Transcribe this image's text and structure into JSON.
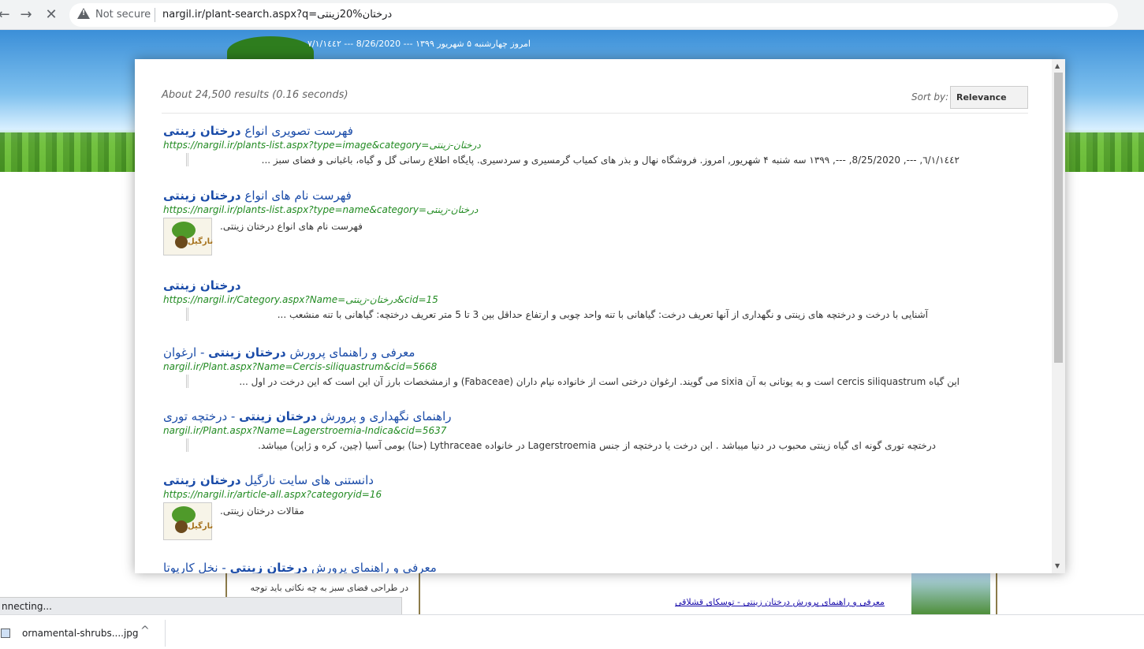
{
  "browser": {
    "back": "←",
    "forward": "→",
    "stop": "✕",
    "not_secure": "Not secure",
    "url": "nargil.ir/plant-search.aspx?q=درختان%20زینتی"
  },
  "page": {
    "date_line": "امروز چهارشنبه ۵ شهریور ۱۳۹۹  ---  8/26/2020  ---  ٧/١/١٤٤٢",
    "bottom_text": "در طراحی فضای سبز به چه نکاتی باید توجه",
    "bottom_link": "معرفی و راهنمای پرورش درختان زینتی - توسکای قشلاقی",
    "status": "nnecting..."
  },
  "download": {
    "file_name": "ornamental-shrubs....jpg",
    "chevron": "^"
  },
  "search": {
    "results_info": "About 24,500 results (0.16 seconds)",
    "sort_label": "Sort by:",
    "sort_value": "Relevance",
    "results": [
      {
        "title_pre": "فهرست تصویری انواع ",
        "title_bold": "درختان زینتی",
        "title_post": "",
        "url": "https://nargil.ir/plants-list.aspx?type=image&category=درختان-زینتی",
        "snippet": "٦/١/١٤٤٢, ---, 8/25/2020, ---, ۱۳۹۹ سه شنبه ۴ شهریور, امروز. فروشگاه نهال و بذر های کمیاب گرمسیری و سردسیری. پایگاه اطلاع رسانی گل و گیاه، باغبانی و فضای سبز ..."
      },
      {
        "title_pre": "فهرست نام های انواع ",
        "title_bold": "درختان زینتی",
        "title_post": "",
        "url": "https://nargil.ir/plants-list.aspx?type=name&category=درختان-زینتی",
        "snippet": "فهرست نام های انواع درختان زینتی."
      },
      {
        "title_pre": "",
        "title_bold": "درختان زینتی",
        "title_post": "",
        "url": "https://nargil.ir/Category.aspx?Name=درختان-زینتی&cid=15",
        "snippet": "آشنایی با درخت و درختچه های زینتی و نگهداری از آنها تعریف درخت: گیاهانی با تنه واحد چوبی و ارتفاع حداقل بین 3 تا 5 متر تعریف درختچه: گیاهانی با تنه منشعب ..."
      },
      {
        "title_pre": "معرفی و راهنمای پرورش ",
        "title_bold": "درختان زینتی",
        "title_post": " - ارغوان",
        "url": "nargil.ir/Plant.aspx?Name=Cercis-siliquastrum&cid=5668",
        "snippet": "این گیاه cercis siliquastrum است و به یونانی به آن sixia می گویند. ارغوان درختی است از خانواده نیام داران (Fabaceae) و ازمشخصات بارز آن این است که این درخت در اول ..."
      },
      {
        "title_pre": "راهنمای نگهداری و پرورش ",
        "title_bold": "درختان زینتی",
        "title_post": " - درختچه توری",
        "url": "nargil.ir/Plant.aspx?Name=Lagerstroemia-Indica&cid=5637",
        "snippet": "درختچه توری گونه ای گیاه زینتی محبوب در دنیا میباشد . این درخت یا درختچه از جنس Lagerstroemia در خانواده Lythraceae (حنا) بومی آسیا (چین، کره و ژاپن) میباشد."
      },
      {
        "title_pre": "دانستنی های سایت نارگیل ",
        "title_bold": "درختان زینتی",
        "title_post": "",
        "url": "https://nargil.ir/article-all.aspx?categoryid=16",
        "snippet": "مقالات درختان زینتی."
      },
      {
        "title_pre": "معرفی و راهنمای پرورش ",
        "title_bold": "درختان زینتی",
        "title_post": " - نخل کاریوتا",
        "url": "",
        "snippet": ""
      }
    ],
    "thumb_text": "نارگیل"
  },
  "colors": {
    "title_blue": "#1a4ba8",
    "url_green": "#228b22",
    "link_blue": "#1a0dab"
  }
}
